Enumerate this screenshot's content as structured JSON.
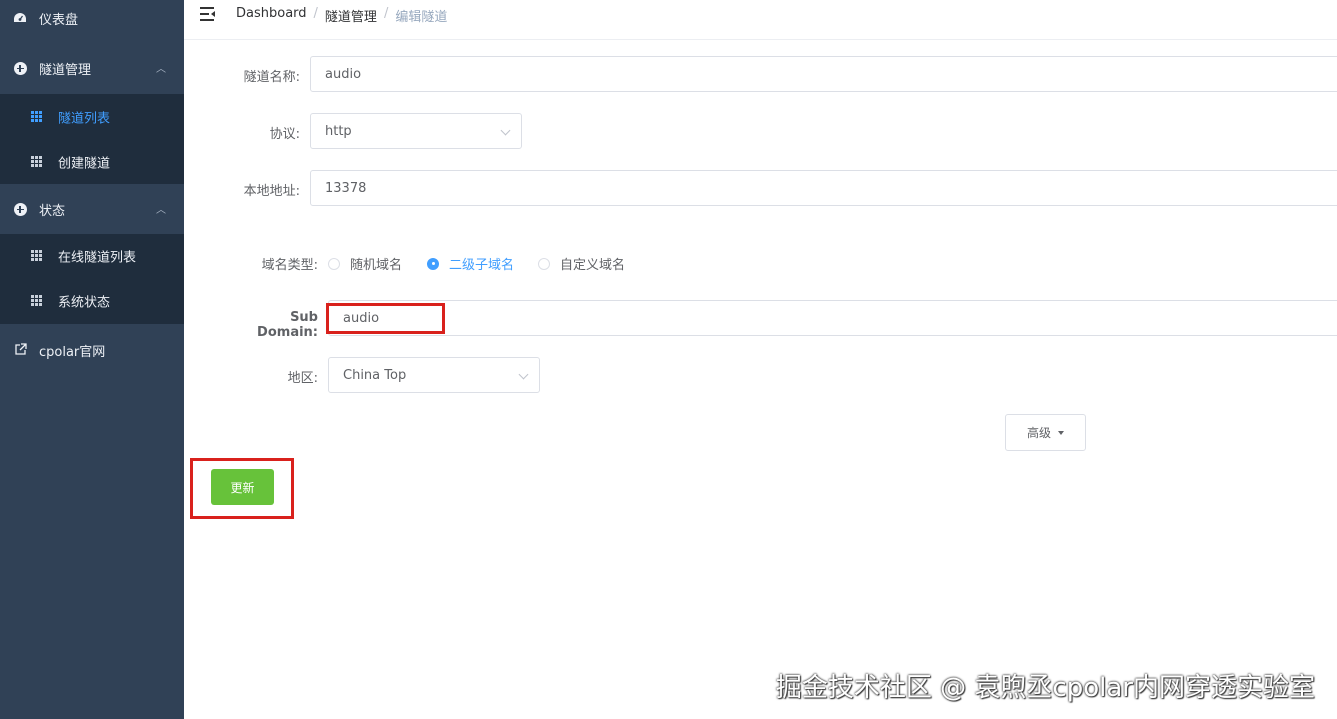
{
  "sidebar": {
    "dashboard_label": "仪表盘",
    "tunnel_mgmt_label": "隧道管理",
    "tunnel_list_label": "隧道列表",
    "create_tunnel_label": "创建隧道",
    "status_label": "状态",
    "online_tunnels_label": "在线隧道列表",
    "system_status_label": "系统状态",
    "cpolar_site_label": "cpolar官网"
  },
  "breadcrumb": {
    "item1": "Dashboard",
    "item2": "隧道管理",
    "item3": "编辑隧道",
    "separator": "/"
  },
  "form": {
    "tunnel_name_label": "隧道名称:",
    "tunnel_name_value": "audio",
    "protocol_label": "协议:",
    "protocol_value": "http",
    "local_addr_label": "本地地址:",
    "local_addr_value": "13378",
    "domain_type_label": "域名类型:",
    "domain_type_options": [
      "随机域名",
      "二级子域名",
      "自定义域名"
    ],
    "domain_type_selected": "二级子域名",
    "subdomain_label": "Sub Domain:",
    "subdomain_value": "audio",
    "region_label": "地区:",
    "region_value": "China Top"
  },
  "buttons": {
    "advanced_label": "高级",
    "update_label": "更新"
  },
  "watermark": "掘金技术社区 @ 袁煦丞cpolar内网穿透实验室",
  "colors": {
    "sidebar_bg": "#304156",
    "submenu_bg": "#1f2d3d",
    "active": "#409eff",
    "update_btn": "#67c23a",
    "highlight": "#d9211c"
  }
}
